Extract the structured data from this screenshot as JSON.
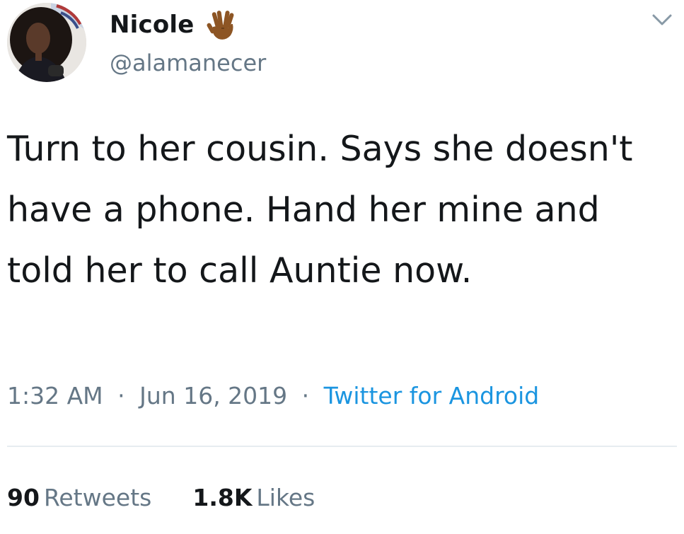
{
  "author": {
    "display_name": "Nicole",
    "emoji_icon": "vulcan-salute-medium-dark-skin-icon",
    "handle": "@alamanecer",
    "avatar": "user-avatar"
  },
  "menu_icon": "chevron-down-icon",
  "tweet": {
    "text": "Turn to her cousin. Says she doesn't have a phone. Hand her mine and told her to call Auntie now."
  },
  "meta": {
    "time": "1:32 AM",
    "separator": "·",
    "date": "Jun 16, 2019",
    "source": "Twitter for Android"
  },
  "stats": {
    "retweets_count": "90",
    "retweets_label": "Retweets",
    "likes_count": "1.8K",
    "likes_label": "Likes"
  },
  "colors": {
    "text": "#14171a",
    "secondary": "#657786",
    "link": "#1b95e0",
    "divider": "#e6ecf0",
    "emoji_skin": "#8d5524"
  }
}
